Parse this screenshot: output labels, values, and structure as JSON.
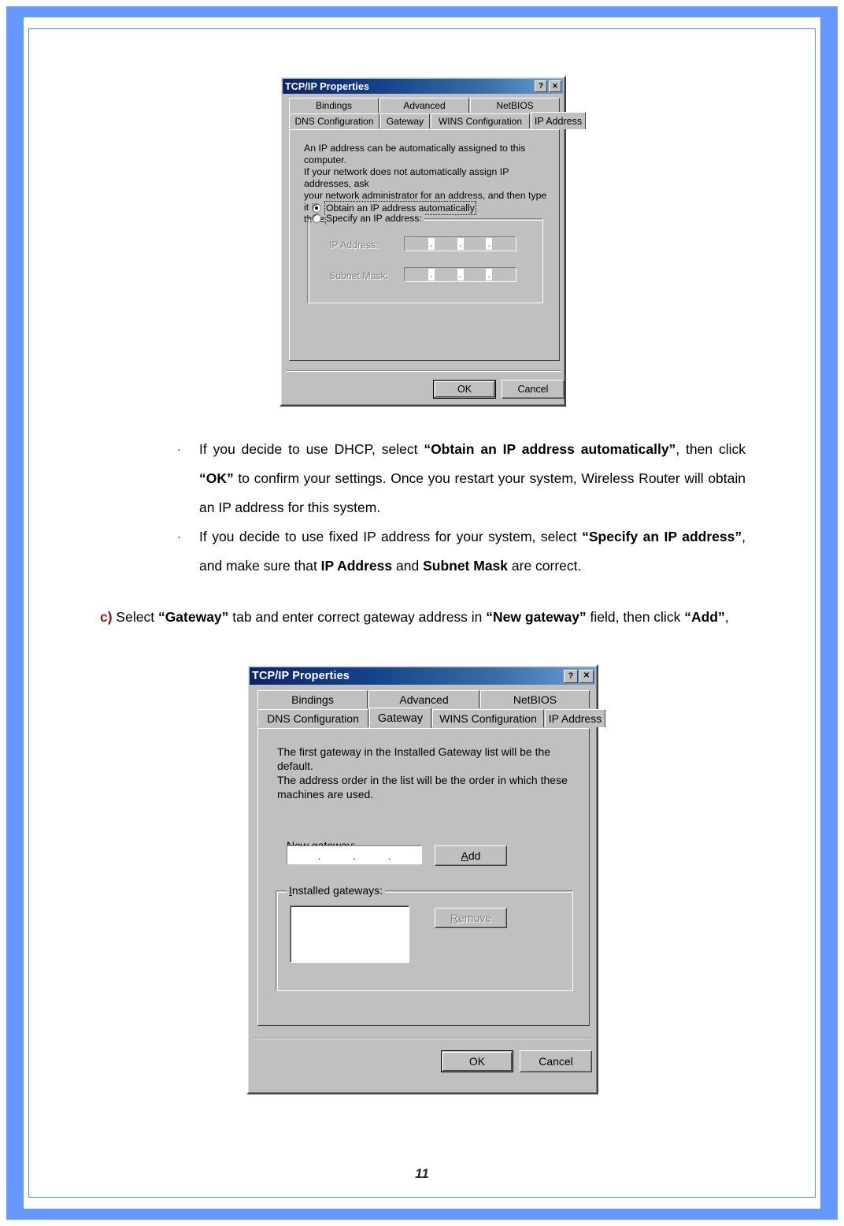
{
  "page": {
    "number": "11",
    "frame_color": "#6699ff",
    "step_label_color": "#8B1A12"
  },
  "dialog_ip": {
    "title": "TCP/IP Properties",
    "help_button": "?",
    "close_button": "✕",
    "tabs_row1": [
      "Bindings",
      "Advanced",
      "NetBIOS"
    ],
    "tabs_row2": [
      "DNS Configuration",
      "Gateway",
      "WINS Configuration",
      "IP Address"
    ],
    "selected_tab": "IP Address",
    "description": "An IP address can be automatically assigned to this computer.\nIf your network does not automatically assign IP addresses, ask\nyour network administrator for an address, and then type it in\nthe space below.",
    "radio_auto": "Obtain an IP address automatically",
    "radio_auto_selected": true,
    "radio_specify": "Specify an IP address:",
    "radio_specify_selected": false,
    "label_ip_address": "IP Address:",
    "label_subnet_mask": "Subnet Mask:",
    "ip_address_value": "",
    "subnet_mask_value": "",
    "ip_separator": ".",
    "fields_enabled": false,
    "ok_button": "OK",
    "cancel_button": "Cancel"
  },
  "bullets": [
    {
      "marker": "·",
      "parts": [
        {
          "t": "If you decide to use DHCP, select ",
          "b": false
        },
        {
          "t": "“Obtain an IP address automatically”",
          "b": true
        },
        {
          "t": ", then click ",
          "b": false
        },
        {
          "t": "“OK”",
          "b": true
        },
        {
          "t": " to confirm your settings. Once you restart your system, Wireless Router will obtain an IP address for this system.",
          "b": false
        }
      ]
    },
    {
      "marker": "·",
      "parts": [
        {
          "t": "If you decide to use fixed IP address for your system, select ",
          "b": false
        },
        {
          "t": "“Specify an IP address”",
          "b": true
        },
        {
          "t": ", and make sure that ",
          "b": false
        },
        {
          "t": "IP Address",
          "b": true
        },
        {
          "t": " and ",
          "b": false
        },
        {
          "t": "Subnet Mask",
          "b": true
        },
        {
          "t": " are correct.",
          "b": false
        }
      ]
    }
  ],
  "step_c": {
    "label": "c)",
    "parts": [
      {
        "t": " Select ",
        "b": false
      },
      {
        "t": "“Gateway”",
        "b": true
      },
      {
        "t": " tab and enter correct gateway address in ",
        "b": false
      },
      {
        "t": "“New gateway”",
        "b": true
      },
      {
        "t": " field, then click ",
        "b": false
      },
      {
        "t": "“Add”",
        "b": true
      },
      {
        "t": ",",
        "b": false
      }
    ]
  },
  "dialog_gateway": {
    "title": "TCP/IP Properties",
    "help_button": "?",
    "close_button": "✕",
    "tabs_row1": [
      "Bindings",
      "Advanced",
      "NetBIOS"
    ],
    "tabs_row2": [
      "DNS Configuration",
      "Gateway",
      "WINS Configuration",
      "IP Address"
    ],
    "selected_tab": "Gateway",
    "description": "The first gateway in the Installed Gateway list will be the default.\nThe address order in the list will be the order in which these\nmachines are used.",
    "label_new_gateway": "New gateway:",
    "new_gateway_value": "",
    "ip_separator": ".",
    "add_button": "Add",
    "add_enabled": true,
    "group_installed": "Installed gateways:",
    "installed_list": [],
    "remove_button": "Remove",
    "remove_enabled": false,
    "ok_button": "OK",
    "cancel_button": "Cancel"
  }
}
